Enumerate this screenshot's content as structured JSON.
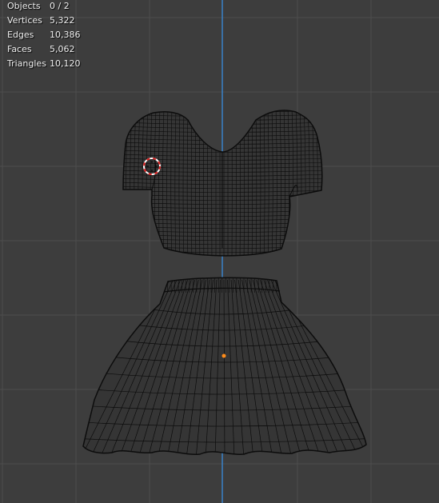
{
  "viewport": {
    "background": "#3d3d3d",
    "grid_color": "#4d4d4d",
    "axis_color": "#3a82c8",
    "mesh_fill": "#353535",
    "wire_color": "#0c0c0c",
    "origin_color": "#ff8c1a",
    "cursor_color_a": "#e02020",
    "cursor_color_b": "#ffffff"
  },
  "stats": [
    {
      "label": "Objects",
      "value": "0 / 2"
    },
    {
      "label": "Vertices",
      "value": "5,322"
    },
    {
      "label": "Edges",
      "value": "10,386"
    },
    {
      "label": "Faces",
      "value": "5,062"
    },
    {
      "label": "Triangles",
      "value": "10,120"
    }
  ],
  "objects": [
    {
      "name": "top",
      "selected": false
    },
    {
      "name": "skirt",
      "selected": false
    }
  ]
}
